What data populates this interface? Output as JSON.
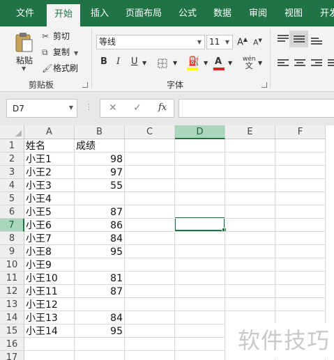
{
  "ribbon_tabs": [
    "文件",
    "开始",
    "插入",
    "页面布局",
    "公式",
    "数据",
    "审阅",
    "视图",
    "开发"
  ],
  "active_tab": "开始",
  "clipboard": {
    "paste": "粘贴",
    "cut": "剪切",
    "copy": "复制",
    "format_painter": "格式刷",
    "group_label": "剪贴板"
  },
  "font": {
    "name": "等线",
    "size": "11",
    "bold": "B",
    "italic": "I",
    "underline": "U",
    "phonetic": "wén",
    "group_label": "字体",
    "fill_color": "#ffff00",
    "font_color": "#e02020"
  },
  "formula_bar": {
    "name_box": "D7",
    "cancel_icon": "✕",
    "enter_icon": "✓",
    "fx_label": "fx",
    "formula": ""
  },
  "sheet": {
    "columns": [
      "A",
      "B",
      "C",
      "D",
      "E",
      "F"
    ],
    "selected_cell": "D7",
    "rows": [
      {
        "n": "1",
        "a": "姓名",
        "b": "成绩"
      },
      {
        "n": "2",
        "a": "小王1",
        "b": "98"
      },
      {
        "n": "3",
        "a": "小王2",
        "b": "97"
      },
      {
        "n": "4",
        "a": "小王3",
        "b": "55"
      },
      {
        "n": "5",
        "a": "小王4",
        "b": ""
      },
      {
        "n": "6",
        "a": "小王5",
        "b": "87"
      },
      {
        "n": "7",
        "a": "小王6",
        "b": "86"
      },
      {
        "n": "8",
        "a": "小王7",
        "b": "84"
      },
      {
        "n": "9",
        "a": "小王8",
        "b": "95"
      },
      {
        "n": "10",
        "a": "小王9",
        "b": ""
      },
      {
        "n": "11",
        "a": "小王10",
        "b": "81"
      },
      {
        "n": "12",
        "a": "小王11",
        "b": "87"
      },
      {
        "n": "13",
        "a": "小王12",
        "b": ""
      },
      {
        "n": "14",
        "a": "小王13",
        "b": "84"
      },
      {
        "n": "15",
        "a": "小王14",
        "b": "95"
      },
      {
        "n": "16",
        "a": "",
        "b": ""
      },
      {
        "n": "17",
        "a": "",
        "b": ""
      }
    ]
  },
  "watermark": "软件技巧",
  "colors": {
    "accent": "#217346",
    "selected_header": "#a9d6bd"
  }
}
